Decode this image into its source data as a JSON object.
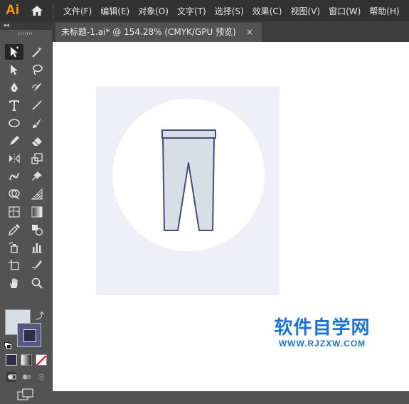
{
  "app": {
    "logo_text": "Ai"
  },
  "menu": {
    "items": [
      "文件(F)",
      "编辑(E)",
      "对象(O)",
      "文字(T)",
      "选择(S)",
      "效果(C)",
      "视图(V)",
      "窗口(W)",
      "帮助(H)"
    ]
  },
  "document": {
    "tab_title": "未标题-1.ai* @ 154.28% (CMYK/GPU 预览)",
    "close_glyph": "×"
  },
  "colors": {
    "fill": "#d8dee5",
    "stroke": "#565680",
    "artboard_bg": "#efeff9",
    "pants_fill": "#d8dee5",
    "pants_stroke": "#4a4a78"
  },
  "tools": [
    [
      "selection-icon",
      "magic-wand-icon"
    ],
    [
      "direct-selection-icon",
      "lasso-icon"
    ],
    [
      "pen-icon",
      "curvature-icon"
    ],
    [
      "type-icon",
      "line-segment-icon"
    ],
    [
      "ellipse-icon",
      "paintbrush-icon"
    ],
    [
      "pencil-icon",
      "eraser-icon"
    ],
    [
      "reflect-icon",
      "scale-icon"
    ],
    [
      "puppet-warp-icon",
      "pin-icon"
    ],
    [
      "shape-builder-icon",
      "perspective-grid-icon"
    ],
    [
      "mesh-icon",
      "gradient-icon"
    ],
    [
      "eyedropper-icon",
      "blend-icon"
    ],
    [
      "symbol-sprayer-icon",
      "column-graph-icon"
    ],
    [
      "artboard-icon",
      "slice-icon"
    ],
    [
      "hand-icon",
      "zoom-icon"
    ]
  ],
  "watermark": {
    "main": "软件自学网",
    "url": "WWW.RJZXW.COM"
  }
}
